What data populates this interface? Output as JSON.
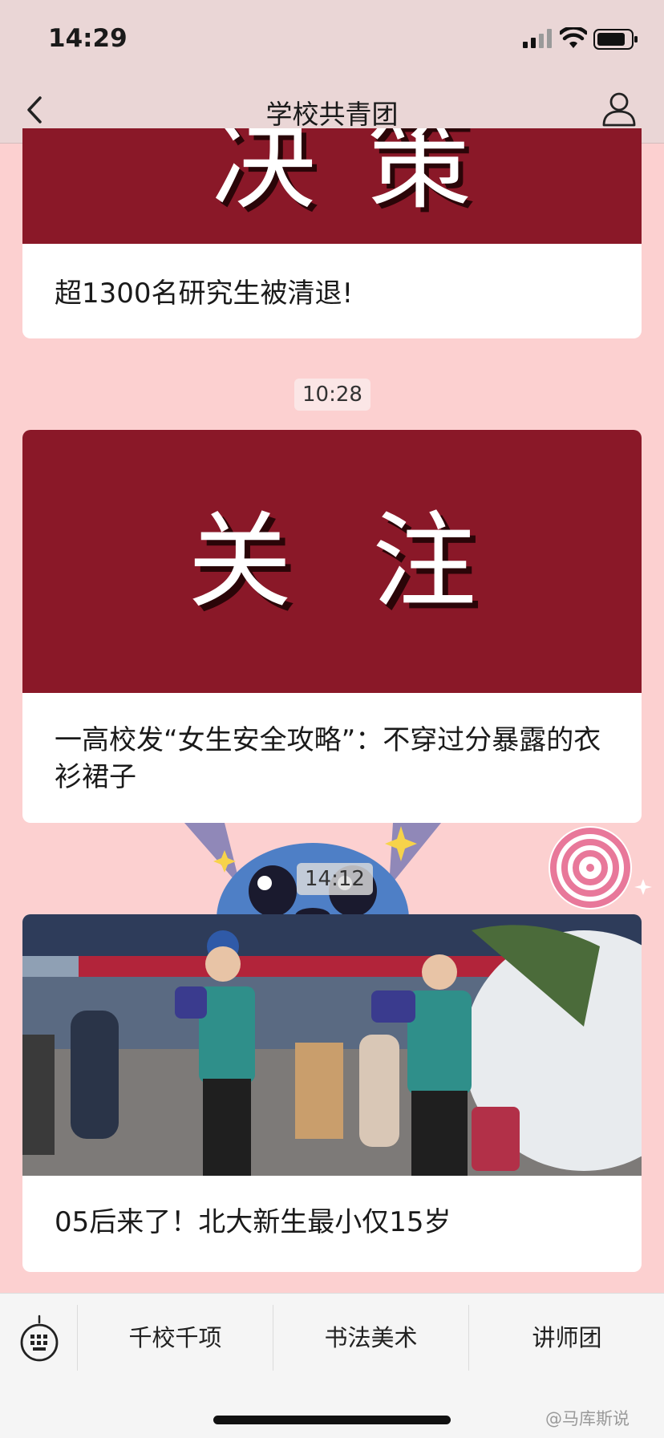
{
  "status_bar": {
    "time": "14:29"
  },
  "nav": {
    "title": "学校共青团"
  },
  "feed": [
    {
      "title": "超1300名研究生被清退!"
    },
    {
      "time": "10:28",
      "banner_text": "关注",
      "title": "一高校发“女生安全攻略”：不穿过分暴露的衣衫裙子"
    },
    {
      "time": "14:12",
      "title": "05后来了！北大新生最小仅15岁"
    }
  ],
  "menu": {
    "items": [
      {
        "label": "千校千项"
      },
      {
        "label": "书法美术"
      },
      {
        "label": "讲师团"
      }
    ]
  },
  "watermark": "@马库斯说",
  "colors": {
    "banner": "#8a1828",
    "background": "#fcd0d0",
    "nav_background": "#ead6d6"
  },
  "icons": [
    "signal-icon",
    "wifi-icon",
    "battery-icon",
    "back-icon",
    "profile-icon",
    "keyboard-icon"
  ]
}
